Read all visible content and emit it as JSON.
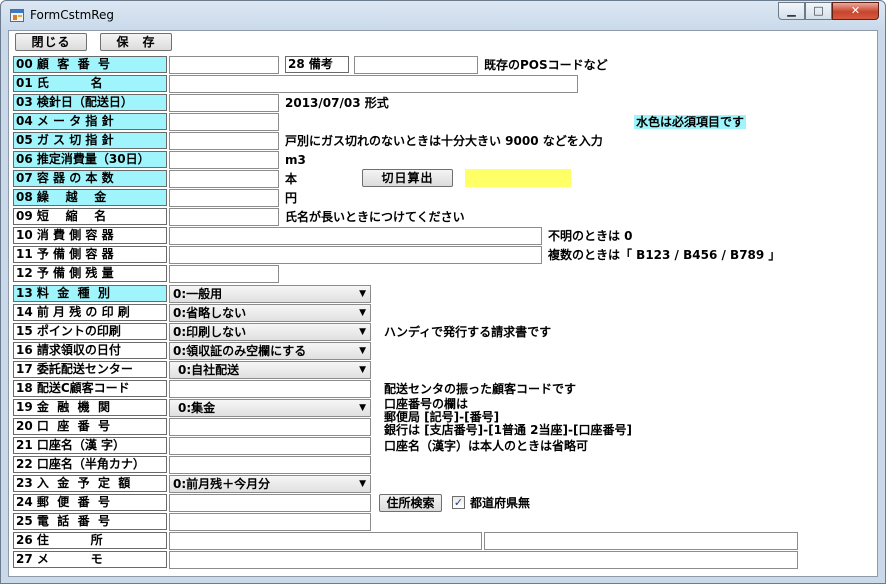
{
  "window": {
    "title": "FormCstmReg"
  },
  "buttons": {
    "close": "閉じる",
    "save": "保　存",
    "calc": "切日算出",
    "addr_search": "住所検索"
  },
  "labels": {
    "l00": "00 顧  客  番  号",
    "l01": "01 氏          名",
    "l03": "03 検針日（配送日）",
    "l04": "04 メ ー タ 指 針",
    "l05": "05 ガ ス 切 指 針",
    "l06": "06 推定消費量（30日）",
    "l07": "07 容 器 の 本 数",
    "l08": "08 繰    越    金",
    "l09": "09 短    縮    名",
    "l10": "10 消 費 側 容 器",
    "l11": "11 予 備 側 容 器",
    "l12": "12 予 備 側 残 量",
    "l13": "13 料  金  種  別",
    "l14": "14 前 月 残 の 印 刷",
    "l15": "15 ポイントの印刷",
    "l16": "16 請求領収の日付",
    "l17": "17 委託配送センター",
    "l18": "18 配送C顧客コード",
    "l19": "19 金  融  機  関",
    "l20": "20 口  座  番  号",
    "l21": "21 口座名（漢 字）",
    "l22": "22 口座名（半角カナ）",
    "l23": "23 入  金  予  定  額",
    "l24": "24 郵  便  番  号",
    "l25": "25 電  話  番  号",
    "l26": "26 住          所",
    "l27": "27 メ          モ",
    "l28": "28 備考"
  },
  "notes": {
    "n00": "既存のPOSコードなど",
    "n03": "2013/07/03 形式",
    "required": "水色は必須項目です",
    "n05": "戸別にガス切れのないときは十分大きい 9000 などを入力",
    "n06": "m3",
    "n07": "本",
    "n08": "円",
    "n09": "氏名が長いときにつけてください",
    "n10": "不明のときは 0",
    "n11": "複数のときは「 B123 / B456 / B789 」",
    "n15": "ハンディで発行する請求書です",
    "n18": "配送センタの振った顧客コードです",
    "n19a": "口座番号の欄は",
    "n19b": "郵便局 [記号]-[番号]",
    "n19c": "銀行は [支店番号]-[1普通 2当座]-[口座番号]",
    "n21": "口座名（漢字）は本人のときは省略可",
    "n24": "都道府県無"
  },
  "selects": {
    "s13": "0:一般用",
    "s14": "0:省略しない",
    "s15": "0:印刷しない",
    "s16": "0:領収証のみ空欄にする",
    "s17": "0:自社配送",
    "s19": "0:集金",
    "s23": "0:前月残＋今月分"
  },
  "checkbox": {
    "prefecture_none": true,
    "mark": "✓"
  },
  "colors": {
    "required_bg": "#9ff5fb",
    "highlight": "#ffff66"
  },
  "icons": {
    "dropdown": "▼",
    "minimize": "▁",
    "maximize": "□",
    "close": "✕"
  }
}
